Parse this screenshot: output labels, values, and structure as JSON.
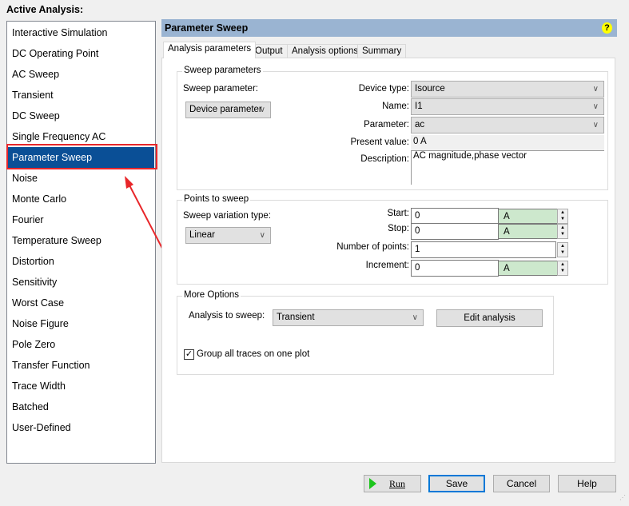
{
  "active_analysis_label": "Active Analysis:",
  "analyses": [
    "Interactive Simulation",
    "DC Operating Point",
    "AC Sweep",
    "Transient",
    "DC Sweep",
    "Single Frequency AC",
    "Parameter Sweep",
    "Noise",
    "Monte Carlo",
    "Fourier",
    "Temperature Sweep",
    "Distortion",
    "Sensitivity",
    "Worst Case",
    "Noise Figure",
    "Pole Zero",
    "Transfer Function",
    "Trace Width",
    "Batched",
    "User-Defined"
  ],
  "selected_analysis": "Parameter Sweep",
  "header": {
    "title": "Parameter Sweep",
    "help_icon": "question-mark-icon"
  },
  "tabs": [
    "Analysis parameters",
    "Output",
    "Analysis options",
    "Summary"
  ],
  "sweep_parameters": {
    "title": "Sweep parameters",
    "sweep_parameter_label": "Sweep parameter:",
    "sweep_parameter_value": "Device parameter",
    "device_type_label": "Device type:",
    "device_type": "Isource",
    "name_label": "Name:",
    "name": "I1",
    "parameter_label": "Parameter:",
    "parameter": "ac",
    "present_value_label": "Present value:",
    "present_value": "0 A",
    "description_label": "Description:",
    "description": "AC magnitude,phase vector"
  },
  "points": {
    "title": "Points to sweep",
    "variation_label": "Sweep variation type:",
    "variation": "Linear",
    "start_label": "Start:",
    "start": "0",
    "start_unit": "A",
    "stop_label": "Stop:",
    "stop": "0",
    "stop_unit": "A",
    "num_label": "Number of points:",
    "num": "1",
    "inc_label": "Increment:",
    "inc": "0",
    "inc_unit": "A"
  },
  "more": {
    "title": "More Options",
    "analysis_label": "Analysis to sweep:",
    "analysis": "Transient",
    "edit_label": "Edit analysis",
    "group_label": "Group all traces on one plot",
    "group_checked": true
  },
  "buttons": {
    "run": "Run",
    "save": "Save",
    "cancel": "Cancel",
    "help": "Help"
  },
  "colors": {
    "selection": "#0a4f96",
    "header": "#9ab4d2",
    "annotation": "#e8262a",
    "unit_bg": "#cde8cd"
  }
}
